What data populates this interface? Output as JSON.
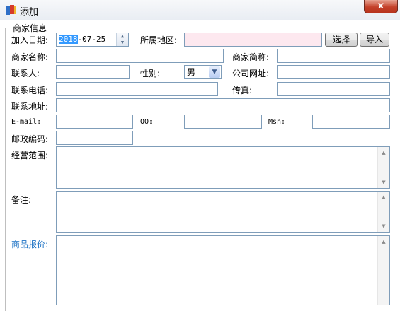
{
  "window": {
    "title": "添加",
    "close_glyph": "x"
  },
  "form": {
    "group_title": "商家信息",
    "join_date": {
      "label": "加入日期:",
      "value_selected": "2018",
      "value_rest": "-07-25"
    },
    "region": {
      "label": "所属地区:",
      "value": ""
    },
    "select_button": "选择",
    "import_button": "导入",
    "merchant_name": {
      "label": "商家名称:",
      "value": ""
    },
    "merchant_short_name": {
      "label": "商家简称:",
      "value": ""
    },
    "contact_person": {
      "label": "联系人:",
      "value": ""
    },
    "gender": {
      "label": "性别:",
      "value": "男"
    },
    "company_website": {
      "label": "公司网址:",
      "value": ""
    },
    "phone": {
      "label": "联系电话:",
      "value": ""
    },
    "fax": {
      "label": "传真:",
      "value": ""
    },
    "address": {
      "label": "联系地址:",
      "value": ""
    },
    "email": {
      "label": "E-mail:",
      "value": ""
    },
    "qq": {
      "label": "QQ:",
      "value": ""
    },
    "msn": {
      "label": "Msn:",
      "value": ""
    },
    "postcode": {
      "label": "邮政编码:",
      "value": ""
    },
    "business_scope": {
      "label": "经营范围:",
      "value": ""
    },
    "remarks": {
      "label": "备注:",
      "value": ""
    },
    "product_quote": {
      "label": "商品报价:",
      "value": ""
    }
  },
  "colors": {
    "region_field_bg": "#fde8ef",
    "quote_label": "#1c72c4",
    "selection": "#3399ff"
  },
  "icons": {
    "app": "book-icon",
    "spinner_up": "triangle-up",
    "spinner_down": "triangle-down",
    "dropdown": "chevron-down",
    "scroll_up": "triangle-up",
    "scroll_down": "triangle-down"
  }
}
